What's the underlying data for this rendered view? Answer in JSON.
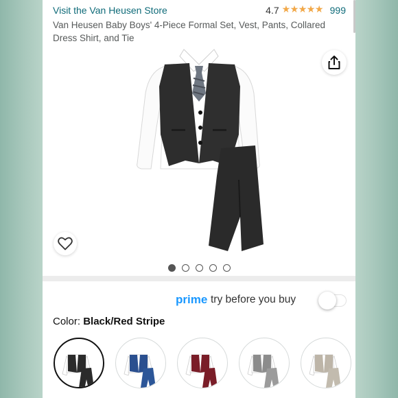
{
  "header": {
    "store_link": "Visit the Van Heusen Store",
    "rating_value": "4.7",
    "rating_stars_fraction": 0.94,
    "review_count": "999",
    "product_title": "Van Heusen Baby Boys' 4-Piece Formal Set, Vest, Pants, Collared Dress Shirt, and Tie"
  },
  "stars_glyph": "★★★★★",
  "image_area": {
    "share_icon": "share-icon",
    "wishlist_icon": "heart-icon",
    "carousel_count": 5,
    "carousel_active_index": 0
  },
  "prime": {
    "word": "prime",
    "text": "try before you buy",
    "toggle_state": "off"
  },
  "color": {
    "label": "Color: ",
    "value": "Black/Red Stripe"
  },
  "swatches": [
    {
      "name": "black",
      "vest": "#2b2b2b",
      "pants": "#2b2b2b",
      "shirt": "#ffffff",
      "selected": true
    },
    {
      "name": "navy",
      "vest": "#2a4f8f",
      "pants": "#2c5698",
      "shirt": "#ffffff",
      "selected": false
    },
    {
      "name": "burgundy",
      "vest": "#7a1d28",
      "pants": "#7a1d28",
      "shirt": "#ffffff",
      "selected": false
    },
    {
      "name": "grey",
      "vest": "#8c8c8c",
      "pants": "#9b9b9b",
      "shirt": "#ffffff",
      "selected": false
    },
    {
      "name": "khaki",
      "vest": "#bdb5a8",
      "pants": "#c2bbae",
      "shirt": "#ffffff",
      "selected": false
    }
  ],
  "colors": {
    "link": "#0f6b79",
    "star": "#f3a847",
    "prime_blue": "#1a98ff"
  }
}
